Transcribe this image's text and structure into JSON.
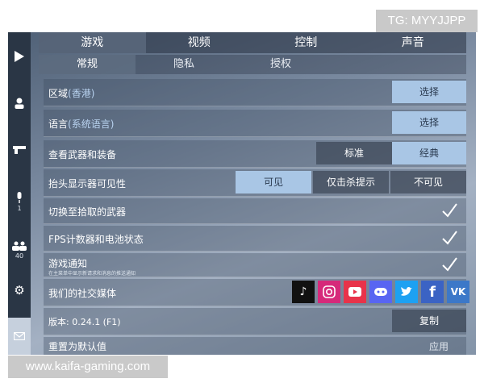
{
  "watermarks": {
    "top": "TG: MYYJJPP",
    "bottom": "www.kaifa-gaming.com"
  },
  "sidebar": {
    "voice_count": "1",
    "friends_count": "40"
  },
  "tabs_main": [
    "游戏",
    "视频",
    "控制",
    "声音"
  ],
  "tabs_sub": [
    "常规",
    "隐私",
    "授权"
  ],
  "settings": {
    "region": {
      "label": "区域",
      "sub": "(香港)",
      "button": "选择"
    },
    "language": {
      "label": "语言",
      "sub": "(系统语言)",
      "button": "选择"
    },
    "weapons": {
      "label": "查看武器和装备",
      "options": [
        "标准",
        "经典"
      ],
      "selected": "经典"
    },
    "hud": {
      "label": "抬头显示器可见性",
      "options": [
        "可见",
        "仅击杀提示",
        "不可见"
      ],
      "selected": "可见"
    },
    "switch_weapon": {
      "label": "切换至拾取的武器",
      "checked": true
    },
    "fps_battery": {
      "label": "FPS计数器和电池状态",
      "checked": true
    },
    "game_notify": {
      "label": "游戏通知",
      "note": "在主菜单中显示新请求和消息的推送通知",
      "checked": true
    },
    "social": {
      "label": "我们的社交媒体"
    },
    "version": {
      "label": "版本: 0.24.1 (F1)",
      "button": "复制"
    },
    "reset": {
      "label": "重置为默认值",
      "button": "应用"
    }
  },
  "social_icons": [
    {
      "name": "tiktok-icon",
      "color": "#111111"
    },
    {
      "name": "instagram-icon",
      "color": "#d6297a"
    },
    {
      "name": "youtube-icon",
      "color": "#e8334a"
    },
    {
      "name": "discord-icon",
      "color": "#5865f2"
    },
    {
      "name": "twitter-icon",
      "color": "#1da1f2"
    },
    {
      "name": "facebook-icon",
      "color": "#3b63c4"
    },
    {
      "name": "vk-icon",
      "color": "#3c78c8"
    }
  ]
}
